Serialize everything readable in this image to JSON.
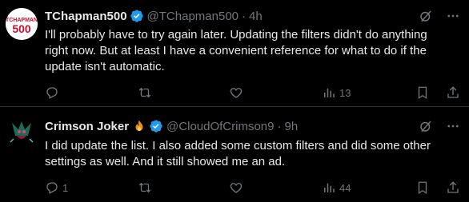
{
  "tweets": [
    {
      "name": "TChapman500",
      "handle": "@TChapman500",
      "separator": "·",
      "time": "4h",
      "avatar_text": "TCHAPMAN 500",
      "text": "I'll probably have to try again later.  Updating the filters didn't do anything right now.  But at least I have a convenient reference for what to do if the update isn't automatic.",
      "text_lines": [
        "I'll probably have to try again later.  Updating the filters didn't do anything",
        "right now.  But at least I have a convenient reference for what to do if the",
        "update isn't automatic."
      ],
      "replies": "",
      "retweets": "",
      "likes": "",
      "views": "13"
    },
    {
      "name": "Crimson Joker",
      "handle": "@CloudOfCrimson9",
      "separator": "·",
      "time": "9h",
      "emoji": "fire-emoji",
      "text_lines": [
        "I did update the list. I also added some custom filters and did some other",
        "settings as well. And it still showed me an ad."
      ],
      "replies": "1",
      "retweets": "",
      "likes": "",
      "views": "44"
    }
  ],
  "colors": {
    "background": "#000000",
    "text": "#e7e9ea",
    "muted": "#71767b",
    "verified": "#1d9bf0",
    "divider": "#2f3336",
    "avatar_red": "#c8102e"
  },
  "icons": [
    "verified-badge-icon",
    "grok-icon",
    "more-icon",
    "reply-icon",
    "retweet-icon",
    "like-icon",
    "views-icon",
    "bookmark-icon",
    "share-icon",
    "fire-emoji"
  ]
}
